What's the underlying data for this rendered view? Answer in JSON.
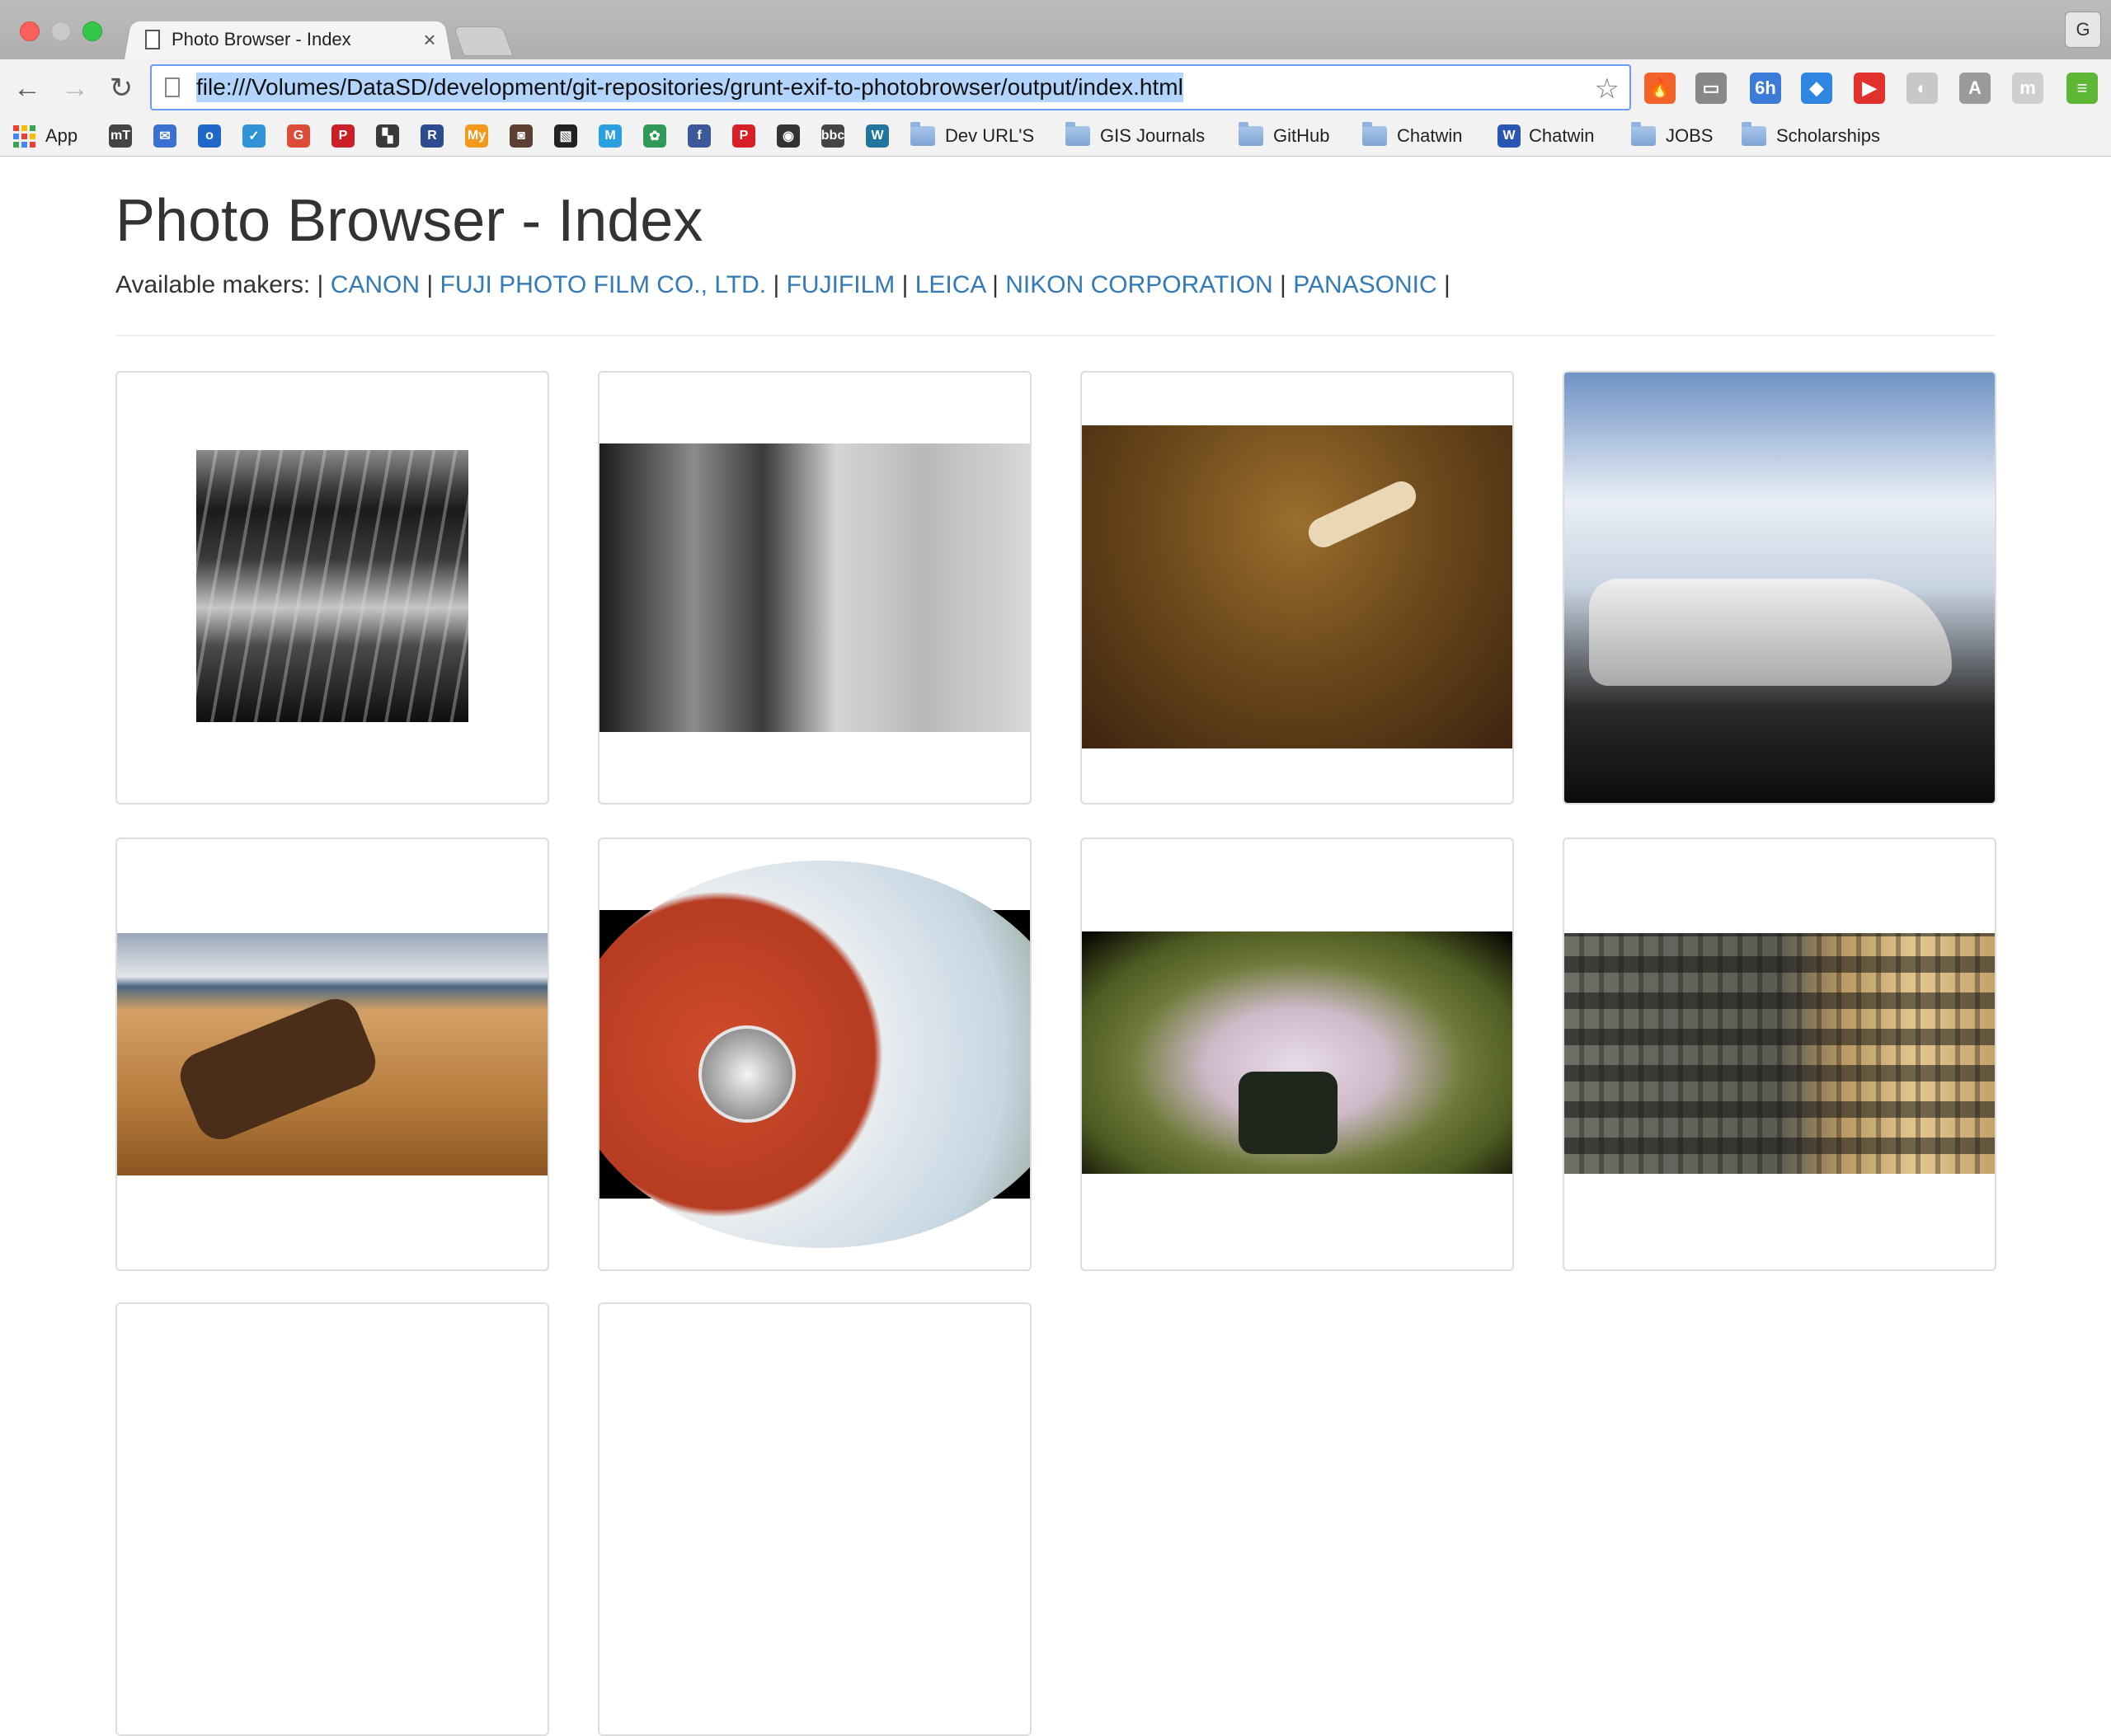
{
  "window": {
    "tab_title": "Photo Browser - Index",
    "tab_close": "×",
    "profile_initial": "G"
  },
  "toolbar": {
    "url": "file:///Volumes/DataSD/development/git-repositories/grunt-exif-to-photobrowser/output/index.html",
    "star": "☆"
  },
  "extensions": [
    {
      "icon": "fire-extension-icon",
      "color": "#f2632a",
      "glyph": "🔥"
    },
    {
      "icon": "cast-icon",
      "color": "#888888",
      "glyph": "▭"
    },
    {
      "icon": "calendar-extension-icon",
      "color": "#3d7bd8",
      "glyph": "6h"
    },
    {
      "icon": "diamond-extension-icon",
      "color": "#2f86e0",
      "glyph": "◆"
    },
    {
      "icon": "play-extension-icon",
      "color": "#e0312d",
      "glyph": "▶"
    },
    {
      "icon": "moon-extension-icon",
      "color": "#c8c8c8",
      "glyph": "◐"
    },
    {
      "icon": "angular-extension-icon",
      "color": "#9a9a9a",
      "glyph": "A"
    },
    {
      "icon": "m-extension-icon",
      "color": "#cfcfcf",
      "glyph": "m"
    },
    {
      "icon": "menu-icon",
      "color": "#5fb737",
      "glyph": "≡"
    }
  ],
  "bookmarks": {
    "apps_label": "App",
    "icons": [
      {
        "icon": "mt-icon",
        "color": "#444444",
        "glyph": "mT"
      },
      {
        "icon": "mail-icon",
        "color": "#3b70d0",
        "glyph": "✉"
      },
      {
        "icon": "outlook-icon",
        "color": "#1f68c9",
        "glyph": "o"
      },
      {
        "icon": "check-icon",
        "color": "#2f93d6",
        "glyph": "✓"
      },
      {
        "icon": "google-plus-icon",
        "color": "#dd4b39",
        "glyph": "G"
      },
      {
        "icon": "pinterest-icon",
        "color": "#cb2027",
        "glyph": "P"
      },
      {
        "icon": "delicious-icon",
        "color": "#3a3a3a",
        "glyph": "▚"
      },
      {
        "icon": "rdt-icon",
        "color": "#2c4c8f",
        "glyph": "R"
      },
      {
        "icon": "my-icon",
        "color": "#f39a1c",
        "glyph": "My"
      },
      {
        "icon": "instagram-icon",
        "color": "#5b4032",
        "glyph": "◙"
      },
      {
        "icon": "stripe-icon",
        "color": "#222222",
        "glyph": "▧"
      },
      {
        "icon": "m-square-icon",
        "color": "#2aa0df",
        "glyph": "M"
      },
      {
        "icon": "gear-green-icon",
        "color": "#2f9a58",
        "glyph": "✿"
      },
      {
        "icon": "facebook-icon",
        "color": "#3b5998",
        "glyph": "f"
      },
      {
        "icon": "p-red-icon",
        "color": "#d71f26",
        "glyph": "P"
      },
      {
        "icon": "cbs-icon",
        "color": "#333333",
        "glyph": "◉"
      },
      {
        "icon": "bbc-icon",
        "color": "#444444",
        "glyph": "bbc"
      },
      {
        "icon": "wordpress-icon",
        "color": "#21759b",
        "glyph": "W"
      }
    ],
    "folders": [
      {
        "label": "Dev URL'S",
        "type": "folder"
      },
      {
        "label": "GIS Journals",
        "type": "folder"
      },
      {
        "label": "GitHub",
        "type": "folder"
      },
      {
        "label": "Chatwin",
        "type": "folder"
      },
      {
        "label": "Chatwin",
        "type": "site"
      },
      {
        "label": "JOBS",
        "type": "folder"
      },
      {
        "label": "Scholarships",
        "type": "folder"
      }
    ]
  },
  "page": {
    "title": "Photo Browser - Index",
    "makers_prefix": "Available makers: |",
    "makers": [
      "CANON",
      "FUJI PHOTO FILM CO., LTD.",
      "FUJIFILM",
      "LEICA",
      "NIKON CORPORATION",
      "PANASONIC"
    ],
    "link_color": "#337ab7"
  }
}
